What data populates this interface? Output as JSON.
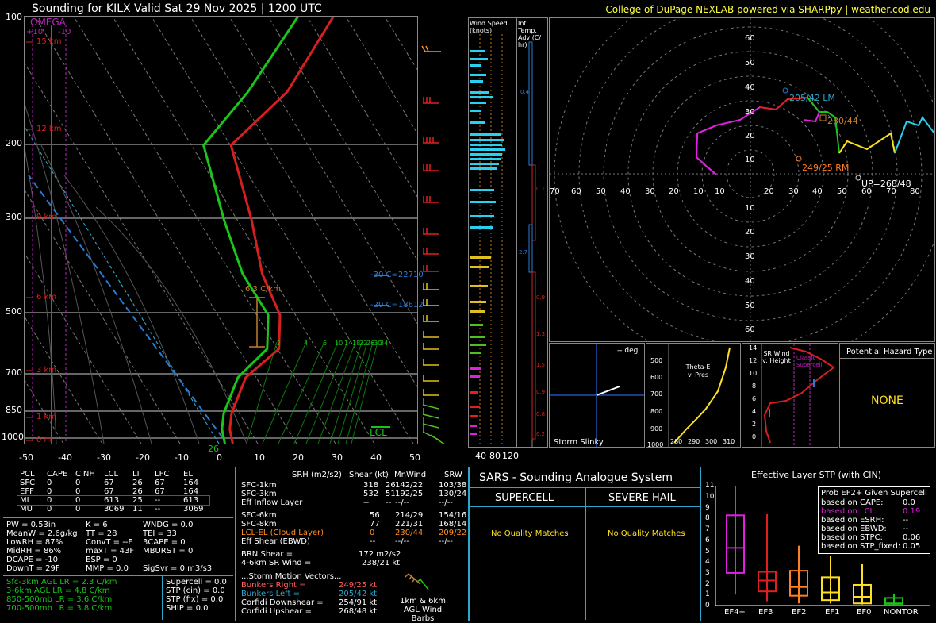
{
  "header": {
    "title": "Sounding for KILX Valid  Sat 29 Nov 2025 | 1200 UTC",
    "credit": "College of DuPage NEXLAB powered via SHARPpy | weather.cod.edu"
  },
  "skewt": {
    "omega_label": "OMEGA",
    "omega_ticks": [
      "+10",
      "-10"
    ],
    "pressures": [
      "100",
      "200",
      "300",
      "500",
      "700",
      "850",
      "1000"
    ],
    "temps": [
      "-50",
      "-40",
      "-30",
      "-20",
      "-10",
      "0",
      "10",
      "20",
      "30",
      "40",
      "50"
    ],
    "heights": [
      "15 km",
      "12 km",
      "9 km",
      "6 km",
      "3 km",
      "1 km",
      "0 m"
    ],
    "lapse_label": "6.3 C/km",
    "iso30": "-30 C=22710",
    "iso20": "-20 C=18612",
    "lcl_label": "LCL",
    "sfc_label": "26",
    "mixing": [
      "2",
      "4",
      "6",
      "10",
      "14",
      "18",
      "22",
      "26",
      "30",
      "34"
    ]
  },
  "wind_speed": {
    "title": "Wind Speed (knots)",
    "ticks": [
      "40",
      "80",
      "120"
    ]
  },
  "temp_adv": {
    "title": "Inf. Temp. Adv (C/ hr)",
    "values": [
      "0.4",
      "0.1",
      "2.7",
      "0.9",
      "1.3",
      "1.5",
      "0.9",
      "0.8",
      "0.2"
    ]
  },
  "hodograph": {
    "rings": [
      "60",
      "50",
      "40",
      "30",
      "20",
      "10"
    ],
    "xlabels": [
      "70",
      "60",
      "50",
      "40",
      "30",
      "20",
      "10",
      "10",
      "20",
      "30",
      "40",
      "50",
      "60",
      "70",
      "80"
    ],
    "lm": "205/42 LM",
    "mean": "230/44",
    "rm": "249/25 RM",
    "up": "UP=268/48"
  },
  "slinky": {
    "title": "Storm Slinky",
    "deg": "-- deg"
  },
  "theta": {
    "title": "Theta-E v. Pres",
    "y": [
      "500",
      "600",
      "700",
      "800",
      "900",
      "1000"
    ],
    "x": [
      "280",
      "290",
      "300",
      "310"
    ]
  },
  "srwind": {
    "title": "SR Wind v. Height",
    "classic": "Classic Supercell",
    "y": [
      "14",
      "12",
      "10",
      "8",
      "6",
      "4",
      "2",
      "0"
    ]
  },
  "hazard": {
    "title": "Potential Hazard Type",
    "value": "NONE"
  },
  "parcels": {
    "headers": [
      "PCL",
      "CAPE",
      "CINH",
      "LCL",
      "LI",
      "LFC",
      "EL"
    ],
    "rows": [
      [
        "SFC",
        "0",
        "0",
        "67",
        "26",
        "67",
        "164"
      ],
      [
        "EFF",
        "0",
        "0",
        "67",
        "26",
        "67",
        "164"
      ],
      [
        "ML",
        "0",
        "0",
        "613",
        "25",
        "--",
        "613"
      ],
      [
        "MU",
        "0",
        "0",
        "3069",
        "11",
        "--",
        "3069"
      ]
    ]
  },
  "indices": [
    [
      "PW = 0.53in",
      "K = 6",
      "WNDG = 0.0"
    ],
    [
      "MeanW = 2.6g/kg",
      "TT = 28",
      "TEI = 33"
    ],
    [
      "LowRH = 87%",
      "ConvT = --F",
      "3CAPE = 0"
    ],
    [
      "MidRH = 86%",
      "maxT = 43F",
      "MBURST = 0"
    ],
    [
      "DCAPE = -10",
      "ESP = 0",
      ""
    ],
    [
      "DownT = 29F",
      "MMP = 0.0",
      "SigSvr = 0 m3/s3"
    ]
  ],
  "lapse": [
    "Sfc-3km AGL LR = 2.3 C/km",
    "3-6km AGL LR = 4.8 C/km",
    "850-500mb LR = 3.6 C/km",
    "700-500mb LR = 3.8 C/km"
  ],
  "composite": [
    "Supercell = 0.0",
    "STP (cin) = 0.0",
    "STP (fix) = 0.0",
    "SHIP = 0.0"
  ],
  "kinematics": {
    "headers": [
      "SRH (m2/s2)",
      "Shear (kt)",
      "MnWind",
      "SRW"
    ],
    "rows": [
      [
        "SFC-1km",
        "318",
        "26",
        "142/22",
        "103/38"
      ],
      [
        "SFC-3km",
        "532",
        "51",
        "192/25",
        "130/24"
      ],
      [
        "Eff Inflow Layer",
        "--",
        "--",
        "--/--",
        "--/--"
      ],
      [
        "SFC-6km",
        "56",
        "214/29",
        "154/16",
        ""
      ],
      [
        "SFC-8km",
        "77",
        "221/31",
        "168/14",
        ""
      ],
      [
        "LCL-EL (Cloud Layer)",
        "0",
        "230/44",
        "209/22",
        ""
      ],
      [
        "Eff Shear (EBWD)",
        "--",
        "--/--",
        "--/--",
        ""
      ]
    ],
    "brn": "BRN Shear =",
    "brn_val": "172 m2/s2",
    "sr46": "4-6km SR Wind =",
    "sr46_val": "238/21 kt",
    "storm": "...Storm Motion Vectors...",
    "br": "Bunkers Right =",
    "br_val": "249/25 kt",
    "bl": "Bunkers Left =",
    "bl_val": "205/42 kt",
    "cdn": "Corfidi Downshear =",
    "cdn_val": "254/91 kt",
    "cup": "Corfidi Upshear =",
    "cup_val": "268/48 kt",
    "barbs": "1km & 6km AGL Wind Barbs"
  },
  "sars": {
    "title": "SARS - Sounding Analogue System",
    "supercell": "SUPERCELL",
    "hail": "SEVERE HAIL",
    "nq1": "No Quality Matches",
    "nq2": "No Quality Matches"
  },
  "stp": {
    "title": "Effective Layer STP (with CIN)",
    "yticks": [
      "11",
      "10",
      "9",
      "8",
      "7",
      "6",
      "5",
      "4",
      "3",
      "2",
      "1",
      "0"
    ],
    "xlabels": [
      "EF4+",
      "EF3",
      "EF2",
      "EF1",
      "EF0",
      "NONTOR"
    ],
    "legend_title": "Prob EF2+ Given Supercell",
    "legend": [
      [
        "based on CAPE:",
        "0.0"
      ],
      [
        "based on LCL:",
        "0.19"
      ],
      [
        "based on ESRH:",
        "--"
      ],
      [
        "based on EBWD:",
        "--"
      ],
      [
        "based on STPC:",
        "0.06"
      ],
      [
        "based on STP_fixed:",
        "0.05"
      ]
    ]
  },
  "chart_data": [
    {
      "type": "line",
      "title": "Sounding for KILX Valid  Sat 29 Nov 2025 | 1200 UTC",
      "xlabel": "",
      "ylabel": "",
      "xlim": [
        -50,
        50
      ],
      "ylim": [
        1000,
        100
      ],
      "series": [
        {
          "name": "",
          "color": "#d62020",
          "values": [
            [
              3,
              1000
            ],
            [
              0,
              925
            ],
            [
              -2,
              850
            ],
            [
              -4,
              700
            ],
            [
              0,
              600
            ],
            [
              -5,
              500
            ],
            [
              -16,
              400
            ],
            [
              -27,
              300
            ],
            [
              -44,
              200
            ],
            [
              -38,
              150
            ],
            [
              -38,
              100
            ]
          ]
        },
        {
          "name": "",
          "color": "#19c519",
          "values": [
            [
              1,
              1000
            ],
            [
              -2,
              925
            ],
            [
              -4,
              850
            ],
            [
              -6,
              700
            ],
            [
              -3,
              600
            ],
            [
              -8,
              500
            ],
            [
              -21,
              400
            ],
            [
              -34,
              300
            ],
            [
              -51,
              200
            ],
            [
              -48,
              150
            ],
            [
              -47,
              100
            ]
          ]
        }
      ]
    },
    {
      "type": "bar",
      "title": "Effective Layer STP (with CIN)",
      "categories": [
        "EF4+",
        "EF3",
        "EF2",
        "EF1",
        "EF0",
        "NONTOR"
      ],
      "series": [
        {
          "name": "",
          "values": [
            5.3,
            2.3,
            1.7,
            1.2,
            0.8,
            0.2
          ]
        }
      ],
      "ylim": [
        0,
        11
      ]
    }
  ]
}
